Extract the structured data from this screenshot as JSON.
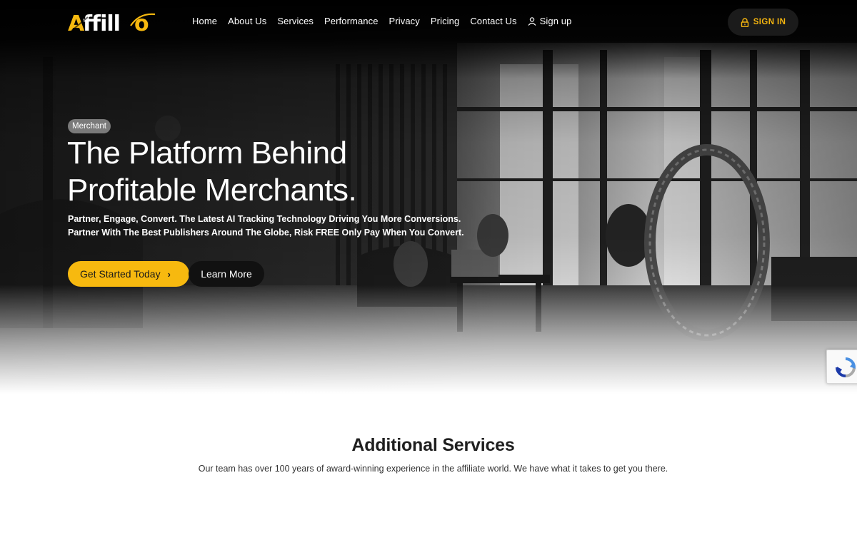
{
  "brand": {
    "logo_text": "Affillo",
    "accent": "#f7b90f",
    "dark": "#111111"
  },
  "nav": {
    "items": [
      "Home",
      "About Us",
      "Services",
      "Performance",
      "Privacy",
      "Pricing",
      "Contact Us"
    ],
    "signup_label": "Sign up",
    "signup_icon": "user-icon",
    "signin_label": "SIGN IN",
    "signin_icon": "lock-icon"
  },
  "hero": {
    "badge": "Merchant",
    "headline_line1": "The Platform Behind",
    "headline_line2": "Profitable Merchants.",
    "sub_line1": "Partner, Engage, Convert. The Latest AI Tracking Technology Driving You More Conversions.",
    "sub_line2": "Partner With The Best Publishers Around The Globe, Risk FREE Only Pay When You Convert.",
    "primary_button": "Get Started Today",
    "primary_button_icon": "chevron-right-icon",
    "secondary_button": "Learn More"
  },
  "services": {
    "title": "Additional Services",
    "subtitle": "Our team has over 100 years of award-winning experience in the affiliate world. We have what it takes to get you there."
  },
  "recaptcha": {
    "icon": "recaptcha-icon"
  }
}
